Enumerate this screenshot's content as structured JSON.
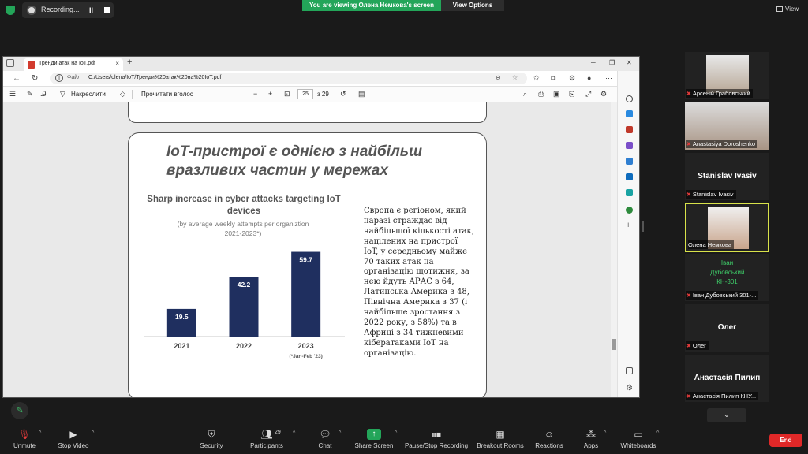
{
  "zoom": {
    "recording_label": "Recording...",
    "pause_icon": "II",
    "viewing_banner": "You are viewing Олена Немкова's screen",
    "view_options": "View Options",
    "view_label": "View"
  },
  "browser": {
    "tab_title": "Тренди атак на IoT.pdf",
    "tab_close": "×",
    "new_tab": "+",
    "url_prefix": "Файл",
    "url": "C:/Users/olena/IoT/Тренди%20атак%20на%20IoT.pdf",
    "pdf_toolbar": {
      "draw_label": "Накреслити",
      "read_aloud_label": "Прочитати вголос",
      "zoom_out": "−",
      "zoom_in": "+",
      "page_current": "25",
      "page_total": "з 29"
    }
  },
  "slide": {
    "title": "IoT-пристрої є однією з найбільш вразливих частин у мережах",
    "chart_title": "Sharp increase in cyber attacks targeting IoT devices",
    "chart_subtitle": "(by average weekly attempts per organiztion 2021-2023*)",
    "chart_footnote": "(*Jan-Feb '23)",
    "body_text": "Європа є регіоном, який наразі страждає від найбільшої кількості атак, націлених на пристрої IoT, у середньому майже 70 таких атак на організацію щотижня, за нею йдуть АРАС з 64, Латинська Америка з 48, Північна Америка з 37 (і найбільше зростання з 2022 року, з 58%) та в Африці з 34 тижневими кібератаками IoT на організацію."
  },
  "chart_data": {
    "type": "bar",
    "title": "Sharp increase in cyber attacks targeting IoT devices",
    "subtitle": "(by average weekly attempts per organiztion 2021-2023*)",
    "categories": [
      "2021",
      "2022",
      "2023"
    ],
    "values": [
      19.5,
      42.2,
      59.7
    ],
    "labels": [
      "19.5",
      "42.2",
      "59.7"
    ],
    "ylim": [
      0,
      70
    ],
    "bar_color": "#1f2f5f",
    "grid": false
  },
  "participants": [
    {
      "name": "Арсеній Грабовський",
      "type": "video"
    },
    {
      "name": "Anastasiya Doroshenko",
      "type": "video"
    },
    {
      "name": "Stanislav Ivasiv",
      "display": "Stanislav Ivasiv",
      "type": "name"
    },
    {
      "name": "Олена Немкова",
      "type": "video",
      "active": true
    },
    {
      "name": "Іван Дубовський 301-...",
      "display": "Іван Дубовський КН-301",
      "type": "name"
    },
    {
      "name": "Олег",
      "display": "Олег",
      "type": "name"
    },
    {
      "name": "Анастасія Пилип КНУ...",
      "display": "Анастасія Пилип",
      "type": "name"
    }
  ],
  "toolbar": {
    "unmute": "Unmute",
    "stop_video": "Stop Video",
    "security": "Security",
    "participants": "Participants",
    "participants_count": "29",
    "chat": "Chat",
    "share_screen": "Share Screen",
    "pause_stop_recording": "Pause/Stop Recording",
    "breakout_rooms": "Breakout Rooms",
    "reactions": "Reactions",
    "apps": "Apps",
    "whiteboards": "Whiteboards",
    "end": "End"
  },
  "colors": {
    "zoom_green": "#23a559",
    "end_red": "#e02828",
    "active_speaker": "#d8e24a",
    "bar_navy": "#1f2f5f"
  }
}
